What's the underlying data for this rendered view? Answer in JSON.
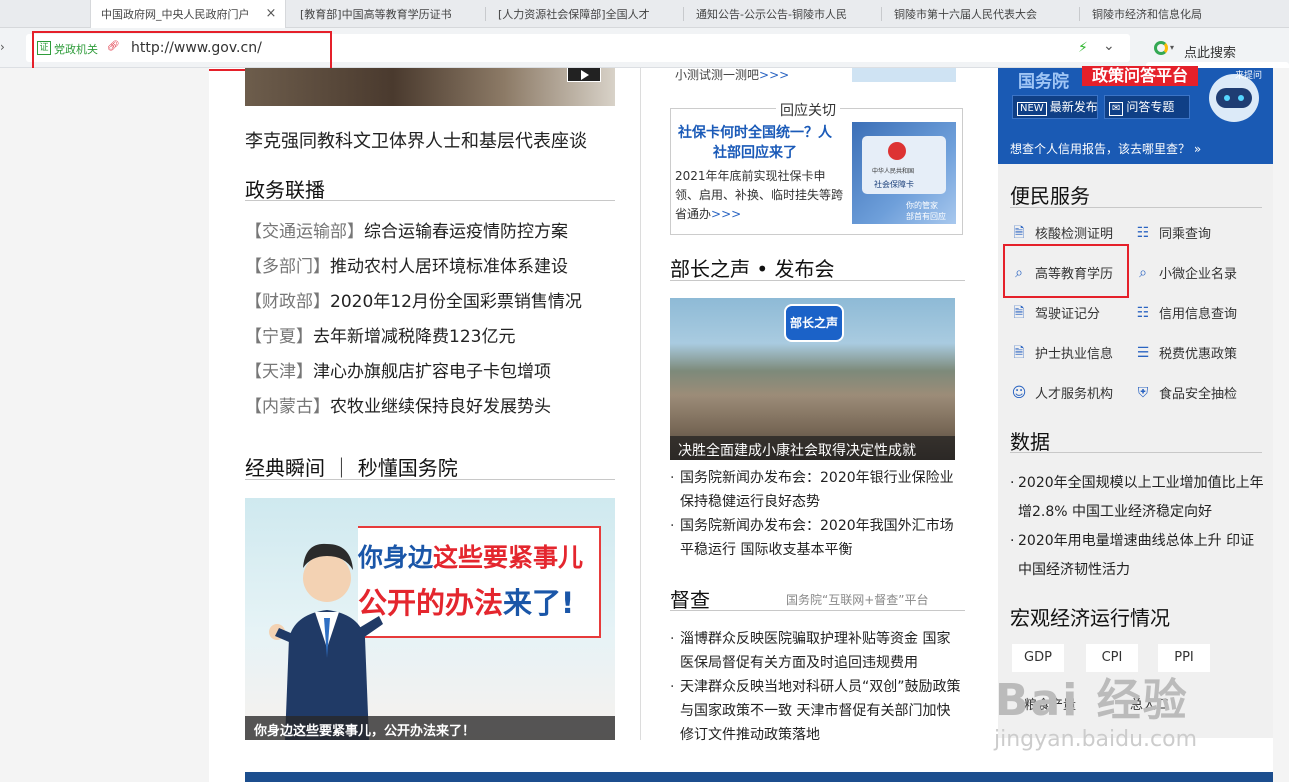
{
  "browser": {
    "tabs": [
      {
        "label": "中国政府网_中央人民政府门户",
        "active": true
      },
      {
        "label": "[教育部]中国高等教育学历证书",
        "active": false
      },
      {
        "label": "[人力资源社会保障部]全国人才",
        "active": false
      },
      {
        "label": "通知公告-公示公告-铜陵市人民",
        "active": false
      },
      {
        "label": "铜陵市第十六届人民代表大会",
        "active": false
      },
      {
        "label": "铜陵市经济和信息化局",
        "active": false
      }
    ],
    "close_glyph": "×",
    "cert_badge": "证",
    "cert_label": "党政机关",
    "url": "http://www.gov.cn/",
    "search_placeholder": "点此搜索"
  },
  "col1": {
    "headline": "李克强同教科文卫体界人士和基层代表座谈",
    "section_news": "政务联播",
    "news": [
      {
        "tag": "【交通运输部】",
        "text": "综合运输春运疫情防控方案"
      },
      {
        "tag": "【多部门】",
        "text": "推动农村人居环境标准体系建设"
      },
      {
        "tag": "【财政部】",
        "text": "2020年12月份全国彩票销售情况"
      },
      {
        "tag": "【宁夏】",
        "text": "去年新增减税降费123亿元"
      },
      {
        "tag": "【天津】",
        "text": "津心办旗舰店扩容电子卡包增项"
      },
      {
        "tag": "【内蒙古】",
        "text": "农牧业继续保持良好发展势头"
      }
    ],
    "section_classic": "经典瞬间 ｜ 秒懂国务院",
    "promo_line1_a": "你身边",
    "promo_line1_b": "这些要紧事儿",
    "promo_line2_a": "公开的办法",
    "promo_line2_b": "来了!",
    "promo_caption": "你身边这些要紧事儿，公开办法来了！"
  },
  "col2": {
    "quiz_text": "小测试测一测吧",
    "quiz_more": ">>>",
    "response_title": "回应关切",
    "response_head": "社保卡何时全国统一？人社部回应来了",
    "response_body": "2021年年底前实现社保卡申领、启用、补换、临时挂失等跨省通办",
    "response_more": ">>>",
    "card_line1": "中华人民共和国",
    "card_line2": "社会保障卡",
    "card_line3": "你的管家",
    "card_line4": "部首有回应",
    "section_minister": "部长之声 • 发布会",
    "minister_badge": "部长之声",
    "minister_caption": "决胜全面建成小康社会取得决定性成就",
    "minister_news": [
      "国务院新闻办发布会：2020年银行业保险业保持稳健运行良好态势",
      "国务院新闻办发布会：2020年我国外汇市场平稳运行 国际收支基本平衡"
    ],
    "section_supervise": "督查",
    "supervise_sub": "国务院“互联网+督查”平台",
    "supervise_news": [
      "淄博群众反映医院骗取护理补贴等资金 国家医保局督促有关方面及时追回违规费用",
      "天津群众反映当地对科研人员“双创”鼓励政策与国家政策不一致 天津市督促有关部门加快修订文件推动政策落地"
    ]
  },
  "col3": {
    "qa_title_a": "国务院",
    "qa_title_b": "政策问答平台",
    "qa_robot_tag": "来提问",
    "qa_btn_new": "最新发布",
    "qa_btn_new_ico": "NEW",
    "qa_btn_topic": "问答专题",
    "qa_link": "想查个人信用报告，该去哪里查？",
    "qa_link_arrow": "»",
    "section_services": "便民服务",
    "services": [
      {
        "label": "核酸检测证明",
        "icon": "doc-icon"
      },
      {
        "label": "同乘查询",
        "icon": "list-icon"
      },
      {
        "label": "高等教育学历",
        "icon": "search-icon"
      },
      {
        "label": "小微企业名录",
        "icon": "search-icon"
      },
      {
        "label": "驾驶证记分",
        "icon": "doc-icon"
      },
      {
        "label": "信用信息查询",
        "icon": "list-icon"
      },
      {
        "label": "护士执业信息",
        "icon": "doc-icon"
      },
      {
        "label": "税费优惠政策",
        "icon": "tax-icon"
      },
      {
        "label": "人才服务机构",
        "icon": "person-icon"
      },
      {
        "label": "食品安全抽检",
        "icon": "shield-icon"
      }
    ],
    "section_data": "数据",
    "data_news": [
      "2020年全国规模以上工业增加值比上年增2.8% 中国工业经济稳定向好",
      "2020年用电量增速曲线总体上升 印证中国经济韧性活力"
    ],
    "section_macro": "宏观经济运行情况",
    "macro_buttons": [
      "GDP",
      "CPI",
      "PPI"
    ],
    "macro_row2": [
      "粮食产量",
      "总人口"
    ],
    "watermark_main": "Bai 经验",
    "watermark_sub": "jingyan.baidu.com"
  }
}
